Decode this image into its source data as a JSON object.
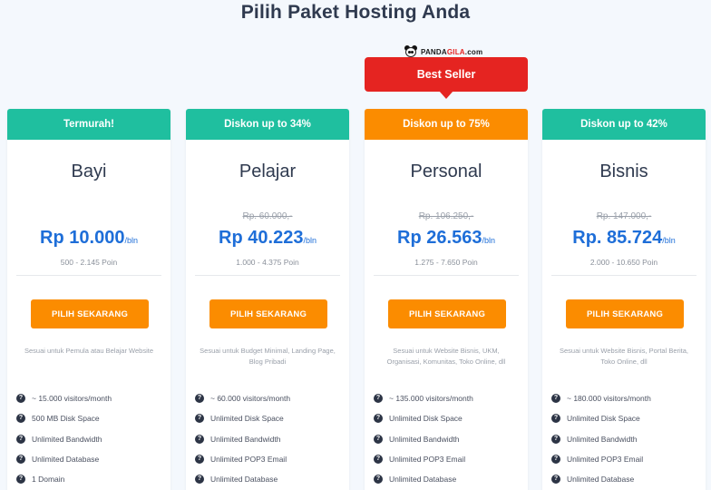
{
  "page": {
    "title": "Pilih Paket Hosting Anda"
  },
  "brand": {
    "logo_text_main": "PANDA",
    "logo_text_accent": "GILA",
    "logo_text_suffix": ".com"
  },
  "badge": {
    "best_seller": "Best Seller"
  },
  "colors": {
    "teal": "#1fbf9f",
    "orange": "#fb8c00",
    "red": "#e52421",
    "price_blue": "#1e6ed8"
  },
  "plans": [
    {
      "header": "Termurah!",
      "header_color": "#1fbf9f",
      "name": "Bayi",
      "old_price": "",
      "price": "Rp 10.000",
      "unit": "/bln",
      "points": "500 - 2.145 Poin",
      "cta": "PILIH SEKARANG",
      "description": "Sesuai untuk Pemula atau Belajar Website",
      "features": [
        "~ 15.000 visitors/month",
        "500 MB Disk Space",
        "Unlimited Bandwidth",
        "Unlimited Database",
        "1 Domain"
      ]
    },
    {
      "header": "Diskon up to 34%",
      "header_color": "#1fbf9f",
      "name": "Pelajar",
      "old_price": "Rp. 60.000,-",
      "price": "Rp 40.223",
      "unit": "/bln",
      "points": "1.000 - 4.375 Poin",
      "cta": "PILIH SEKARANG",
      "description": "Sesuai untuk Budget Minimal, Landing Page, Blog Pribadi",
      "features": [
        "~ 60.000 visitors/month",
        "Unlimited Disk Space",
        "Unlimited Bandwidth",
        "Unlimited POP3 Email",
        "Unlimited Database"
      ]
    },
    {
      "header": "Diskon up to 75%",
      "header_color": "#fb8c00",
      "name": "Personal",
      "old_price": "Rp. 106.250,-",
      "price": "Rp 26.563",
      "unit": "/bln",
      "points": "1.275 - 7.650 Poin",
      "cta": "PILIH SEKARANG",
      "description": "Sesuai untuk Website Bisnis, UKM, Organisasi, Komunitas, Toko Online, dll",
      "features": [
        "~ 135.000 visitors/month",
        "Unlimited Disk Space",
        "Unlimited Bandwidth",
        "Unlimited POP3 Email",
        "Unlimited Database"
      ]
    },
    {
      "header": "Diskon up to 42%",
      "header_color": "#1fbf9f",
      "name": "Bisnis",
      "old_price": "Rp. 147.000,-",
      "price": "Rp. 85.724",
      "unit": "/bln",
      "points": "2.000 - 10.650 Poin",
      "cta": "PILIH SEKARANG",
      "description": "Sesuai untuk Website Bisnis, Portal Berita, Toko Online, dll",
      "features": [
        "~ 180.000 visitors/month",
        "Unlimited Disk Space",
        "Unlimited Bandwidth",
        "Unlimited POP3 Email",
        "Unlimited Database"
      ]
    }
  ]
}
